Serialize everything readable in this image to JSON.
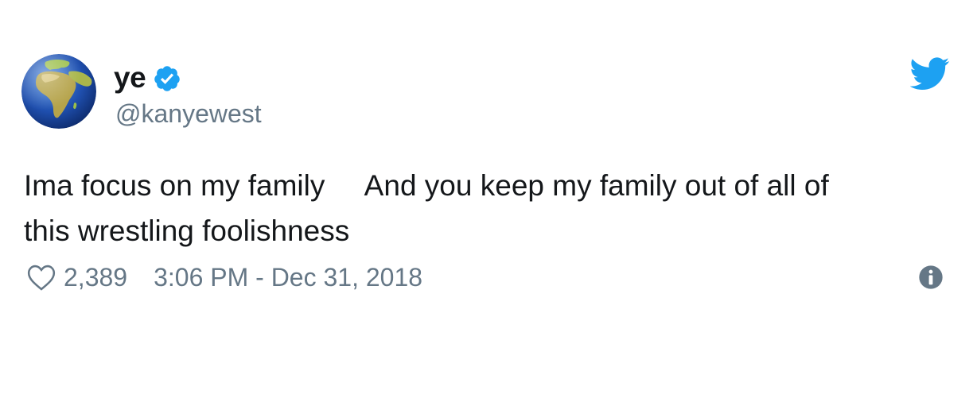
{
  "user": {
    "display_name": "ye",
    "handle": "@kanyewest",
    "verified": true,
    "avatar_icon": "earth-globe-africa-emoji"
  },
  "tweet": {
    "text": "Ima focus on my family     And you keep my family out of all of\nthis wrestling foolishness"
  },
  "footer": {
    "like_icon": "heart-outline-icon",
    "likes": "2,389",
    "timestamp": "3:06 PM - Dec 31, 2018",
    "info_icon": "info-circle-icon"
  },
  "brand": {
    "icon": "twitter-bird-icon",
    "accent_color": "#1da1f2",
    "secondary_text_color": "#657786"
  }
}
